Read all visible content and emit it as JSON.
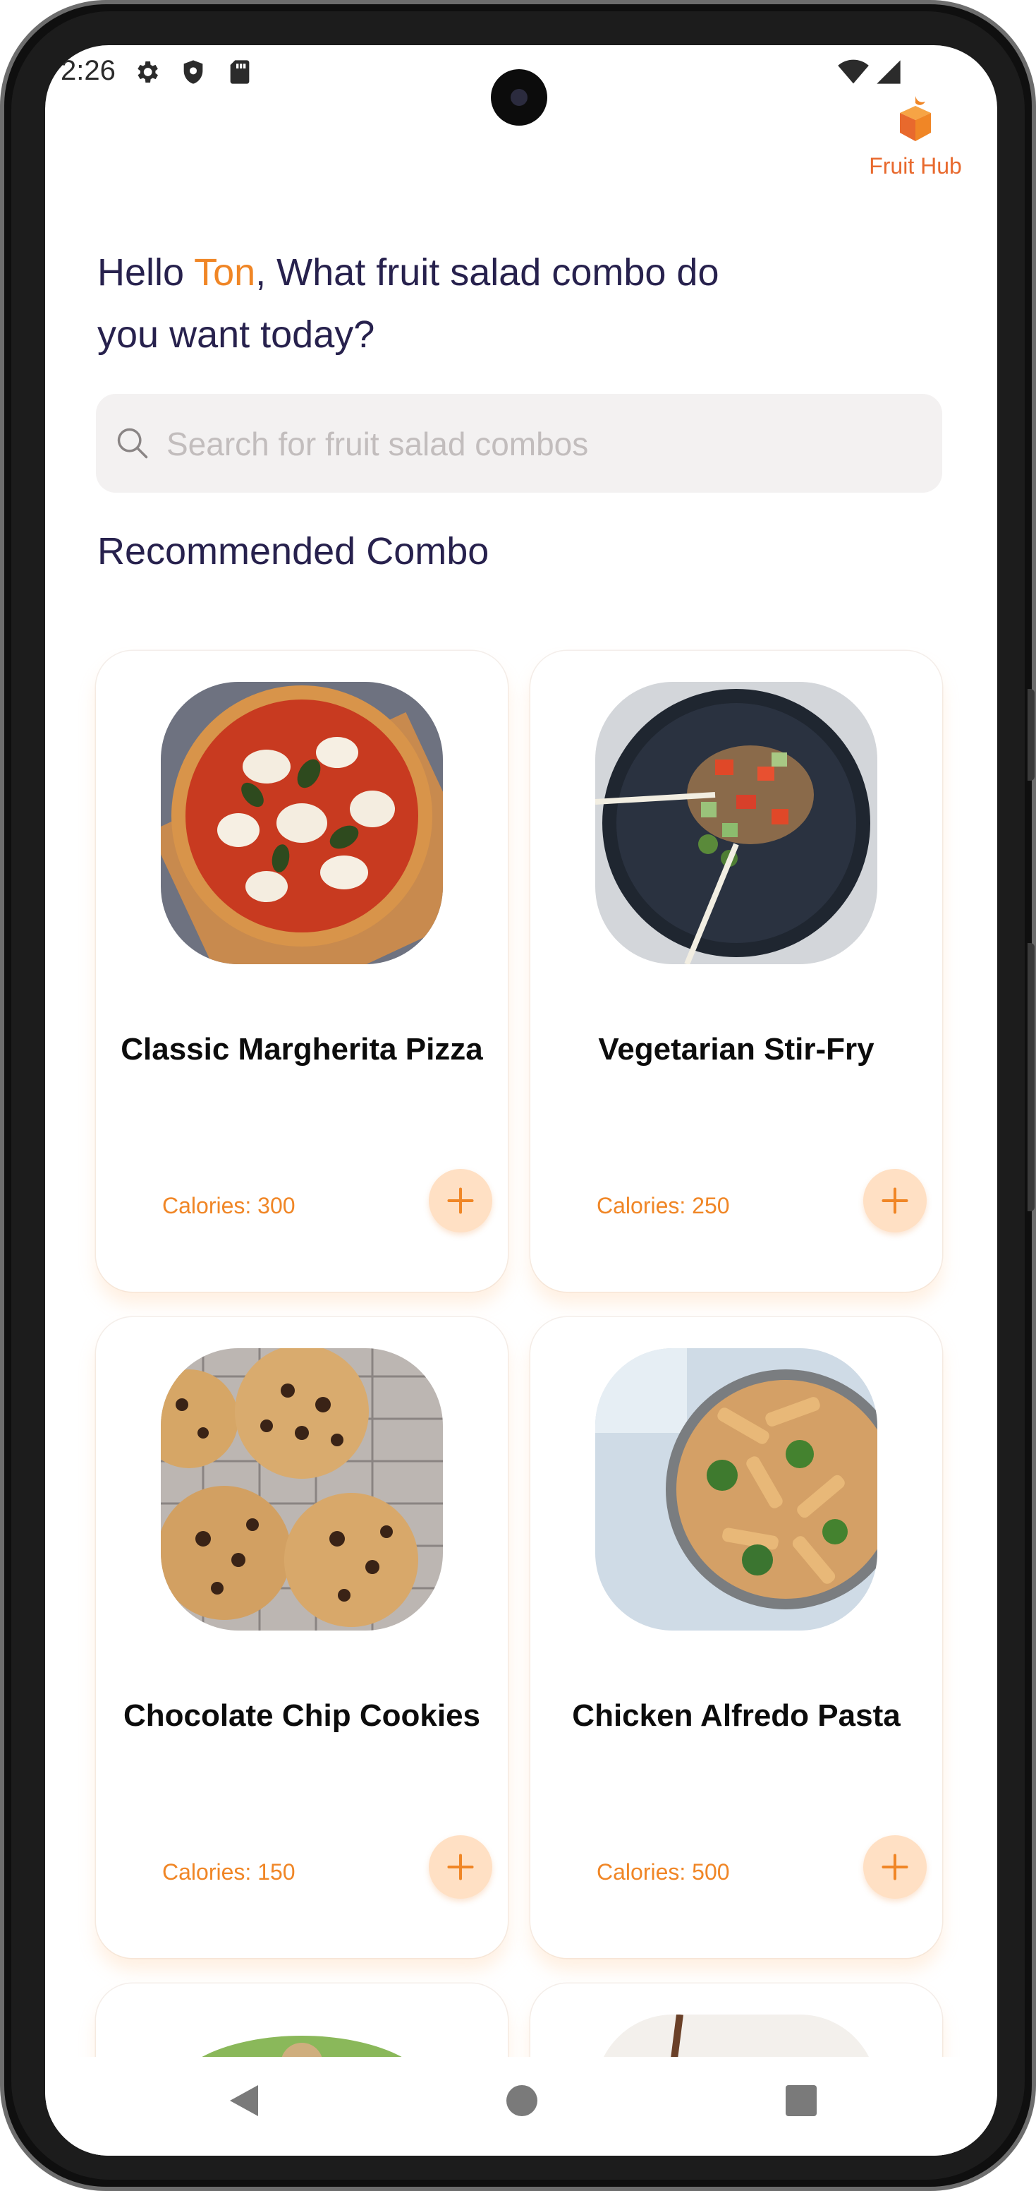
{
  "status_bar": {
    "time": "2:26",
    "icons": [
      "gear-icon",
      "shield-icon",
      "sd-card-icon",
      "wifi-icon",
      "cell-signal-icon"
    ]
  },
  "brand": {
    "label": "Fruit Hub",
    "icon": "fruit-basket-icon",
    "color": "#e8692d"
  },
  "greeting": {
    "prefix": "Hello ",
    "name": "Ton",
    "suffix": ", What fruit salad combo do you want today?"
  },
  "search": {
    "placeholder": "Search for fruit salad combos",
    "value": ""
  },
  "section": {
    "title": "Recommended Combo"
  },
  "cards": [
    {
      "name": "Classic Margherita Pizza",
      "calories": "Calories: 300",
      "image": "pizza-image"
    },
    {
      "name": "Vegetarian Stir-Fry",
      "calories": "Calories: 250",
      "image": "stir-fry-image"
    },
    {
      "name": "Chocolate Chip Cookies",
      "calories": "Calories: 150",
      "image": "cookies-image"
    },
    {
      "name": "Chicken Alfredo Pasta",
      "calories": "Calories: 500",
      "image": "pasta-image"
    }
  ],
  "nav": {
    "buttons": [
      "back-icon",
      "home-icon",
      "recents-icon"
    ]
  },
  "colors": {
    "accent": "#f08626",
    "heading": "#27214d",
    "search_bg": "#f3f1f1",
    "add_button_bg": "#ffe0c4"
  }
}
